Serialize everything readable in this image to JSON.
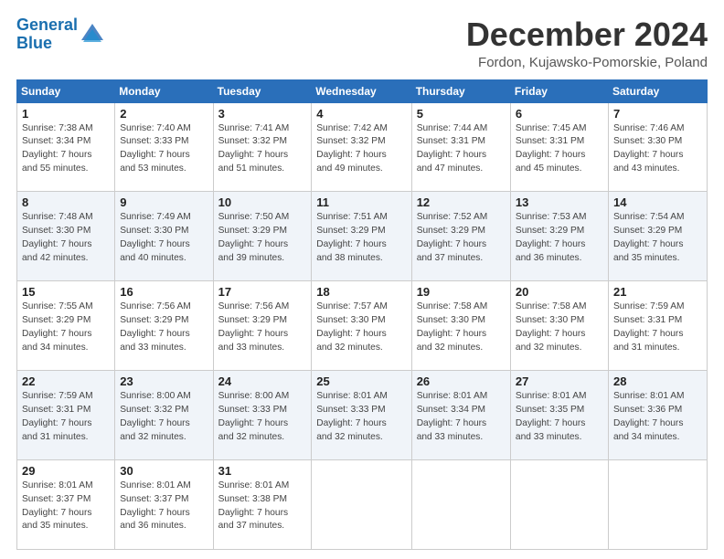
{
  "header": {
    "logo_line1": "General",
    "logo_line2": "Blue",
    "month_title": "December 2024",
    "location": "Fordon, Kujawsko-Pomorskie, Poland"
  },
  "weekdays": [
    "Sunday",
    "Monday",
    "Tuesday",
    "Wednesday",
    "Thursday",
    "Friday",
    "Saturday"
  ],
  "weeks": [
    [
      {
        "day": "1",
        "info": "Sunrise: 7:38 AM\nSunset: 3:34 PM\nDaylight: 7 hours\nand 55 minutes."
      },
      {
        "day": "2",
        "info": "Sunrise: 7:40 AM\nSunset: 3:33 PM\nDaylight: 7 hours\nand 53 minutes."
      },
      {
        "day": "3",
        "info": "Sunrise: 7:41 AM\nSunset: 3:32 PM\nDaylight: 7 hours\nand 51 minutes."
      },
      {
        "day": "4",
        "info": "Sunrise: 7:42 AM\nSunset: 3:32 PM\nDaylight: 7 hours\nand 49 minutes."
      },
      {
        "day": "5",
        "info": "Sunrise: 7:44 AM\nSunset: 3:31 PM\nDaylight: 7 hours\nand 47 minutes."
      },
      {
        "day": "6",
        "info": "Sunrise: 7:45 AM\nSunset: 3:31 PM\nDaylight: 7 hours\nand 45 minutes."
      },
      {
        "day": "7",
        "info": "Sunrise: 7:46 AM\nSunset: 3:30 PM\nDaylight: 7 hours\nand 43 minutes."
      }
    ],
    [
      {
        "day": "8",
        "info": "Sunrise: 7:48 AM\nSunset: 3:30 PM\nDaylight: 7 hours\nand 42 minutes."
      },
      {
        "day": "9",
        "info": "Sunrise: 7:49 AM\nSunset: 3:30 PM\nDaylight: 7 hours\nand 40 minutes."
      },
      {
        "day": "10",
        "info": "Sunrise: 7:50 AM\nSunset: 3:29 PM\nDaylight: 7 hours\nand 39 minutes."
      },
      {
        "day": "11",
        "info": "Sunrise: 7:51 AM\nSunset: 3:29 PM\nDaylight: 7 hours\nand 38 minutes."
      },
      {
        "day": "12",
        "info": "Sunrise: 7:52 AM\nSunset: 3:29 PM\nDaylight: 7 hours\nand 37 minutes."
      },
      {
        "day": "13",
        "info": "Sunrise: 7:53 AM\nSunset: 3:29 PM\nDaylight: 7 hours\nand 36 minutes."
      },
      {
        "day": "14",
        "info": "Sunrise: 7:54 AM\nSunset: 3:29 PM\nDaylight: 7 hours\nand 35 minutes."
      }
    ],
    [
      {
        "day": "15",
        "info": "Sunrise: 7:55 AM\nSunset: 3:29 PM\nDaylight: 7 hours\nand 34 minutes."
      },
      {
        "day": "16",
        "info": "Sunrise: 7:56 AM\nSunset: 3:29 PM\nDaylight: 7 hours\nand 33 minutes."
      },
      {
        "day": "17",
        "info": "Sunrise: 7:56 AM\nSunset: 3:29 PM\nDaylight: 7 hours\nand 33 minutes."
      },
      {
        "day": "18",
        "info": "Sunrise: 7:57 AM\nSunset: 3:30 PM\nDaylight: 7 hours\nand 32 minutes."
      },
      {
        "day": "19",
        "info": "Sunrise: 7:58 AM\nSunset: 3:30 PM\nDaylight: 7 hours\nand 32 minutes."
      },
      {
        "day": "20",
        "info": "Sunrise: 7:58 AM\nSunset: 3:30 PM\nDaylight: 7 hours\nand 32 minutes."
      },
      {
        "day": "21",
        "info": "Sunrise: 7:59 AM\nSunset: 3:31 PM\nDaylight: 7 hours\nand 31 minutes."
      }
    ],
    [
      {
        "day": "22",
        "info": "Sunrise: 7:59 AM\nSunset: 3:31 PM\nDaylight: 7 hours\nand 31 minutes."
      },
      {
        "day": "23",
        "info": "Sunrise: 8:00 AM\nSunset: 3:32 PM\nDaylight: 7 hours\nand 32 minutes."
      },
      {
        "day": "24",
        "info": "Sunrise: 8:00 AM\nSunset: 3:33 PM\nDaylight: 7 hours\nand 32 minutes."
      },
      {
        "day": "25",
        "info": "Sunrise: 8:01 AM\nSunset: 3:33 PM\nDaylight: 7 hours\nand 32 minutes."
      },
      {
        "day": "26",
        "info": "Sunrise: 8:01 AM\nSunset: 3:34 PM\nDaylight: 7 hours\nand 33 minutes."
      },
      {
        "day": "27",
        "info": "Sunrise: 8:01 AM\nSunset: 3:35 PM\nDaylight: 7 hours\nand 33 minutes."
      },
      {
        "day": "28",
        "info": "Sunrise: 8:01 AM\nSunset: 3:36 PM\nDaylight: 7 hours\nand 34 minutes."
      }
    ],
    [
      {
        "day": "29",
        "info": "Sunrise: 8:01 AM\nSunset: 3:37 PM\nDaylight: 7 hours\nand 35 minutes."
      },
      {
        "day": "30",
        "info": "Sunrise: 8:01 AM\nSunset: 3:37 PM\nDaylight: 7 hours\nand 36 minutes."
      },
      {
        "day": "31",
        "info": "Sunrise: 8:01 AM\nSunset: 3:38 PM\nDaylight: 7 hours\nand 37 minutes."
      },
      null,
      null,
      null,
      null
    ]
  ]
}
